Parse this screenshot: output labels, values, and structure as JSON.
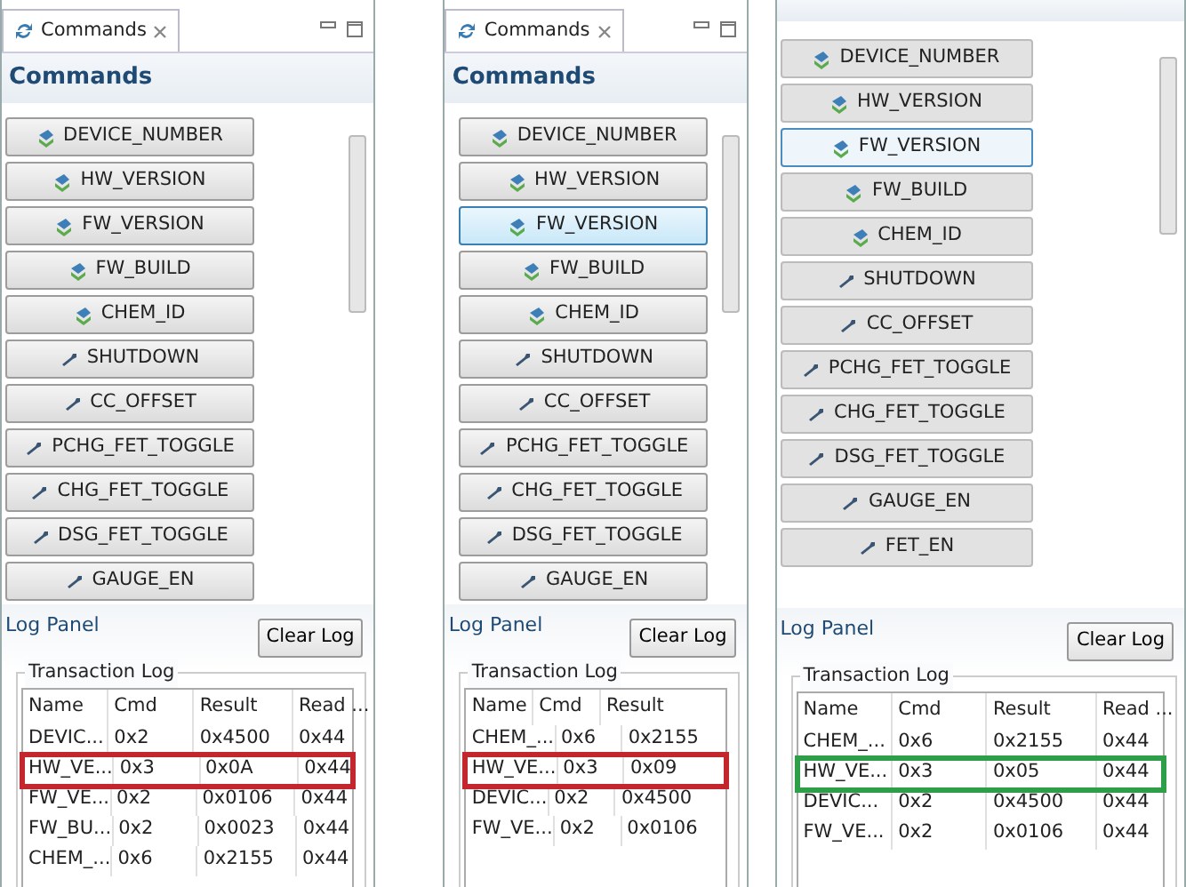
{
  "panels": [
    {
      "tab": {
        "label": "Commands"
      },
      "heading": "Commands",
      "commands": [
        {
          "label": "DEVICE_NUMBER",
          "kind": "read",
          "selected": false
        },
        {
          "label": "HW_VERSION",
          "kind": "read",
          "selected": false
        },
        {
          "label": "FW_VERSION",
          "kind": "read",
          "selected": false
        },
        {
          "label": "FW_BUILD",
          "kind": "read",
          "selected": false
        },
        {
          "label": "CHEM_ID",
          "kind": "read",
          "selected": false
        },
        {
          "label": "SHUTDOWN",
          "kind": "write",
          "selected": false
        },
        {
          "label": "CC_OFFSET",
          "kind": "write",
          "selected": false
        },
        {
          "label": "PCHG_FET_TOGGLE",
          "kind": "write",
          "selected": false
        },
        {
          "label": "CHG_FET_TOGGLE",
          "kind": "write",
          "selected": false
        },
        {
          "label": "DSG_FET_TOGGLE",
          "kind": "write",
          "selected": false
        },
        {
          "label": "GAUGE_EN",
          "kind": "write",
          "selected": false
        }
      ],
      "log": {
        "title": "Log Panel",
        "button": "Clear Log",
        "group": "Transaction Log",
        "columns": [
          "Name",
          "Cmd",
          "Result",
          "Read ..."
        ],
        "rows": [
          {
            "cells": [
              "DEVIC...",
              "0x2",
              "0x4500",
              "0x44"
            ]
          },
          {
            "cells": [
              "HW_VE...",
              "0x3",
              "0x0A",
              "0x44"
            ],
            "color": "#c4262e"
          },
          {
            "cells": [
              "FW_VE...",
              "0x2",
              "0x0106",
              "0x44"
            ]
          },
          {
            "cells": [
              "FW_BU...",
              "0x2",
              "0x0023",
              "0x44"
            ]
          },
          {
            "cells": [
              "CHEM_...",
              "0x6",
              "0x2155",
              "0x44"
            ]
          }
        ]
      }
    },
    {
      "tab": {
        "label": "Commands"
      },
      "heading": "Commands",
      "commands": [
        {
          "label": "DEVICE_NUMBER",
          "kind": "read",
          "selected": false
        },
        {
          "label": "HW_VERSION",
          "kind": "read",
          "selected": false
        },
        {
          "label": "FW_VERSION",
          "kind": "read",
          "selected": true
        },
        {
          "label": "FW_BUILD",
          "kind": "read",
          "selected": false
        },
        {
          "label": "CHEM_ID",
          "kind": "read",
          "selected": false
        },
        {
          "label": "SHUTDOWN",
          "kind": "write",
          "selected": false
        },
        {
          "label": "CC_OFFSET",
          "kind": "write",
          "selected": false
        },
        {
          "label": "PCHG_FET_TOGGLE",
          "kind": "write",
          "selected": false
        },
        {
          "label": "CHG_FET_TOGGLE",
          "kind": "write",
          "selected": false
        },
        {
          "label": "DSG_FET_TOGGLE",
          "kind": "write",
          "selected": false
        },
        {
          "label": "GAUGE_EN",
          "kind": "write",
          "selected": false
        }
      ],
      "log": {
        "title": "Log Panel",
        "button": "Clear Log",
        "group": "Transaction Log",
        "columns": [
          "Name",
          "Cmd",
          "Result"
        ],
        "rows": [
          {
            "cells": [
              "CHEM_...",
              "0x6",
              "0x2155"
            ]
          },
          {
            "cells": [
              "HW_VE...",
              "0x3",
              "0x09"
            ],
            "color": "#c4262e"
          },
          {
            "cells": [
              "DEVIC...",
              "0x2",
              "0x4500"
            ]
          },
          {
            "cells": [
              "FW_VE...",
              "0x2",
              "0x0106"
            ]
          }
        ]
      }
    },
    {
      "commands": [
        {
          "label": "DEVICE_NUMBER",
          "kind": "read",
          "selected": false
        },
        {
          "label": "HW_VERSION",
          "kind": "read",
          "selected": false
        },
        {
          "label": "FW_VERSION",
          "kind": "read",
          "selected": true
        },
        {
          "label": "FW_BUILD",
          "kind": "read",
          "selected": false
        },
        {
          "label": "CHEM_ID",
          "kind": "read",
          "selected": false
        },
        {
          "label": "SHUTDOWN",
          "kind": "write",
          "selected": false
        },
        {
          "label": "CC_OFFSET",
          "kind": "write",
          "selected": false
        },
        {
          "label": "PCHG_FET_TOGGLE",
          "kind": "write",
          "selected": false
        },
        {
          "label": "CHG_FET_TOGGLE",
          "kind": "write",
          "selected": false
        },
        {
          "label": "DSG_FET_TOGGLE",
          "kind": "write",
          "selected": false
        },
        {
          "label": "GAUGE_EN",
          "kind": "write",
          "selected": false
        },
        {
          "label": "FET_EN",
          "kind": "write",
          "selected": false
        }
      ],
      "log": {
        "title": "Log Panel",
        "button": "Clear Log",
        "group": "Transaction Log",
        "columns": [
          "Name",
          "Cmd",
          "Result",
          "Read ..."
        ],
        "rows": [
          {
            "cells": [
              "CHEM_...",
              "0x6",
              "0x2155",
              "0x44"
            ]
          },
          {
            "cells": [
              "HW_VE...",
              "0x3",
              "0x05",
              "0x44"
            ],
            "color": "#2e9e48"
          },
          {
            "cells": [
              "DEVIC...",
              "0x2",
              "0x4500",
              "0x44"
            ]
          },
          {
            "cells": [
              "FW_VE...",
              "0x2",
              "0x0106",
              "0x44"
            ]
          }
        ]
      }
    }
  ]
}
